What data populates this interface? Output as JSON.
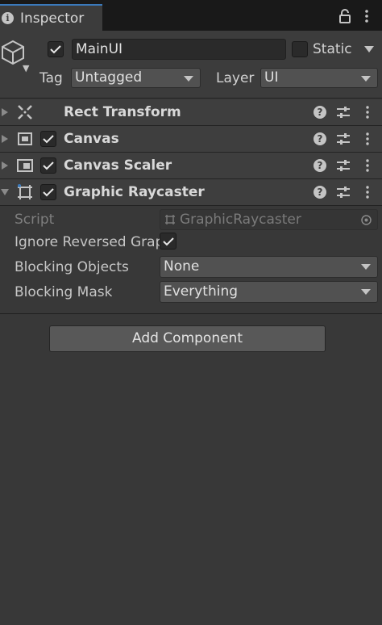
{
  "tab": {
    "title": "Inspector"
  },
  "gameobject": {
    "name": "MainUI",
    "active": true,
    "static_label": "Static",
    "tag_label": "Tag",
    "tag_value": "Untagged",
    "layer_label": "Layer",
    "layer_value": "UI"
  },
  "components": [
    {
      "title": "Rect Transform",
      "icon": "rect-transform-icon",
      "has_checkbox": false,
      "expanded": false
    },
    {
      "title": "Canvas",
      "icon": "canvas-icon",
      "has_checkbox": true,
      "expanded": false
    },
    {
      "title": "Canvas Scaler",
      "icon": "canvas-scaler-icon",
      "has_checkbox": true,
      "expanded": false
    },
    {
      "title": "Graphic Raycaster",
      "icon": "graphic-raycaster-icon",
      "has_checkbox": true,
      "expanded": true
    }
  ],
  "properties": {
    "script_label": "Script",
    "script_value": "GraphicRaycaster",
    "ignore_reversed_label": "Ignore Reversed Graphics",
    "ignore_reversed_checked": true,
    "blocking_objects_label": "Blocking Objects",
    "blocking_objects_value": "None",
    "blocking_mask_label": "Blocking Mask",
    "blocking_mask_value": "Everything"
  },
  "add_component_label": "Add Component",
  "colors": {
    "background": "#383838",
    "tab_accent": "#3a79bb",
    "header": "#3c3c3c",
    "field": "#2a2a2a",
    "dropdown": "#515151",
    "button": "#585858"
  }
}
